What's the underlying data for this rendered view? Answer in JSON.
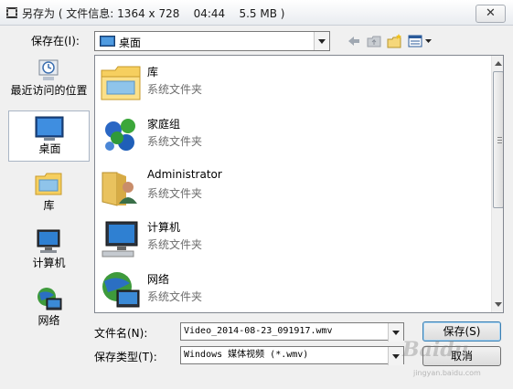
{
  "window": {
    "title": "另存为 ( 文件信息: 1364 x 728    04:44    5.5 MB )",
    "close_label": "✕"
  },
  "toolbar": {
    "save_in_label": "保存在(I):",
    "location": "桌面",
    "back_icon": "back-arrow-icon",
    "up_icon": "up-folder-icon",
    "new_folder_icon": "new-folder-icon",
    "view_icon": "view-menu-icon"
  },
  "places": [
    {
      "label": "最近访问的位置",
      "icon": "recent-places-icon",
      "selected": false
    },
    {
      "label": "桌面",
      "icon": "desktop-icon",
      "selected": true
    },
    {
      "label": "库",
      "icon": "library-icon",
      "selected": false
    },
    {
      "label": "计算机",
      "icon": "computer-icon",
      "selected": false
    },
    {
      "label": "网络",
      "icon": "network-icon",
      "selected": false
    }
  ],
  "files": [
    {
      "name": "库",
      "type": "系统文件夹",
      "icon": "library-folder-icon"
    },
    {
      "name": "家庭组",
      "type": "系统文件夹",
      "icon": "homegroup-icon"
    },
    {
      "name": "Administrator",
      "type": "系统文件夹",
      "icon": "user-folder-icon"
    },
    {
      "name": "计算机",
      "type": "系统文件夹",
      "icon": "computer-icon"
    },
    {
      "name": "网络",
      "type": "系统文件夹",
      "icon": "network-icon"
    }
  ],
  "form": {
    "filename_label": "文件名(N):",
    "filename_value": "Video_2014-08-23_091917.wmv",
    "filetype_label": "保存类型(T):",
    "filetype_value": "Windows 媒体视频 (*.wmv)",
    "save_button": "保存(S)",
    "cancel_button": "取消"
  },
  "watermark": {
    "text": "Baidu",
    "sub": "jingyan.baidu.com"
  }
}
